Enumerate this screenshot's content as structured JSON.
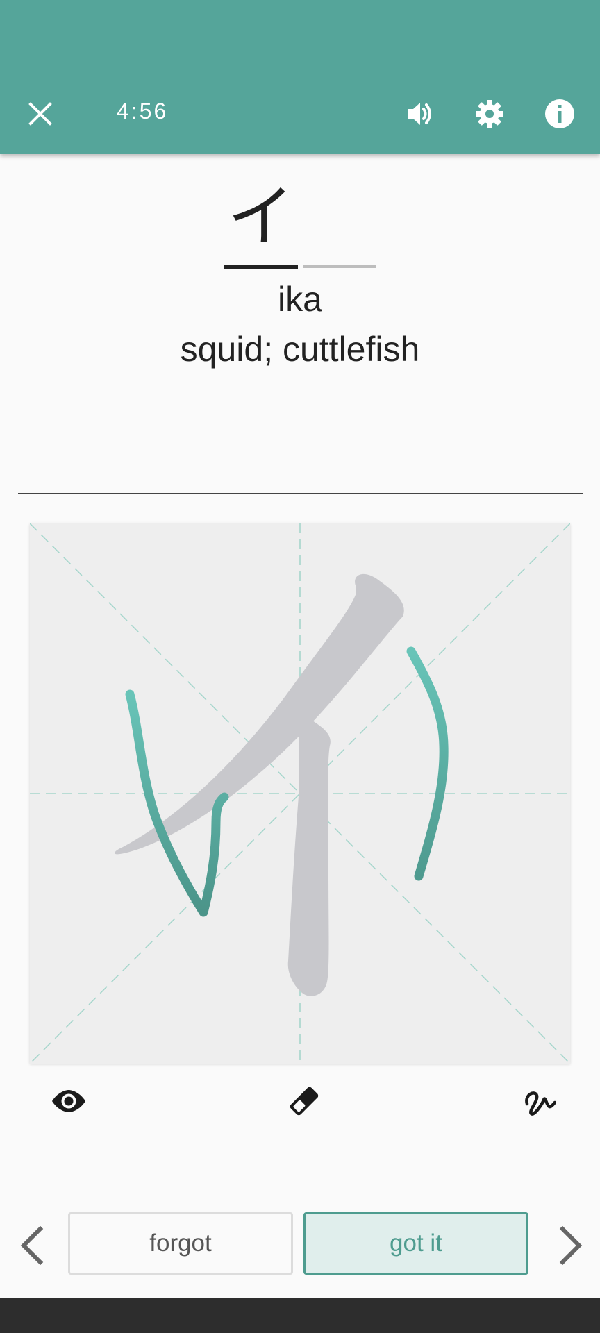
{
  "header": {
    "timer": "4:56",
    "icons": {
      "close": "close-icon",
      "sound": "volume-icon",
      "settings": "gear-icon",
      "info": "info-icon"
    },
    "accent_color": "#55a59a"
  },
  "card": {
    "kana": [
      "イ",
      ""
    ],
    "active_index": 0,
    "reading": "ika",
    "meaning": "squid; cuttlefish"
  },
  "canvas": {
    "hint_character": "イ",
    "hint_color": "#c8c8cc",
    "user_stroke_color": "#5bb5a8"
  },
  "tools": {
    "icons": [
      "eye-icon",
      "eraser-icon",
      "stroke-icon"
    ]
  },
  "actions": {
    "forgot_label": "forgot",
    "got_it_label": "got it"
  },
  "nav": {
    "prev_icon": "chevron-left-icon",
    "next_icon": "chevron-right-icon"
  }
}
